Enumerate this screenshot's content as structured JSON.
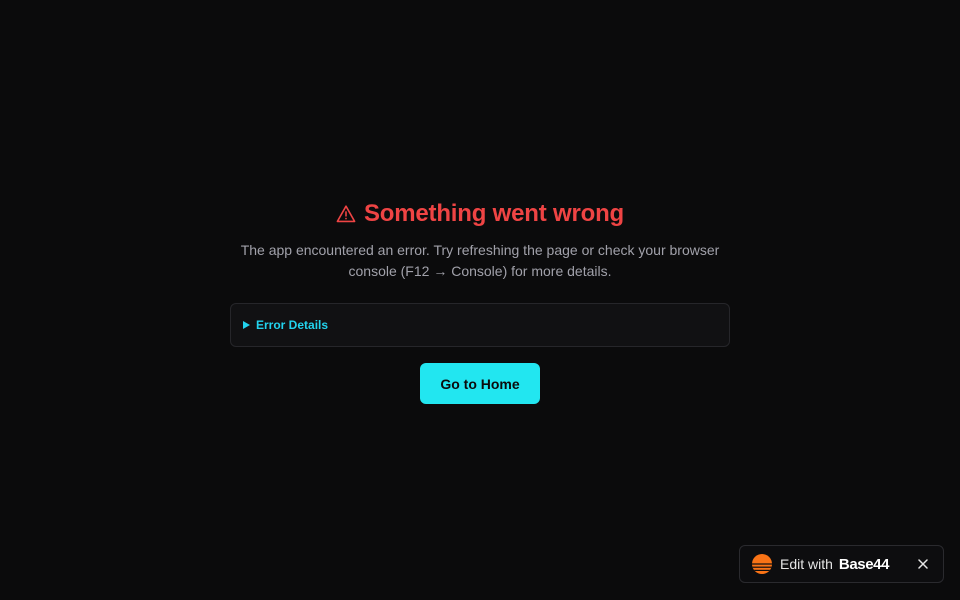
{
  "error": {
    "title": "Something went wrong",
    "message": "The app encountered an error. Try refreshing the page or check your browser console (F12 → Console) for more details.",
    "details_label": "Error Details",
    "home_button_label": "Go to Home"
  },
  "badge": {
    "label": "Edit with",
    "brand": "Base44"
  },
  "colors": {
    "background": "#0b0b0c",
    "error": "#ef4444",
    "accent": "#22e6f0",
    "details_text": "#22d3ee",
    "muted_text": "#a1a1aa",
    "logo": "#f97316"
  },
  "icons": {
    "title": "warning-icon",
    "details": "triangle-right-icon",
    "badge_logo": "base44-logo-icon",
    "badge_close": "close-icon"
  }
}
